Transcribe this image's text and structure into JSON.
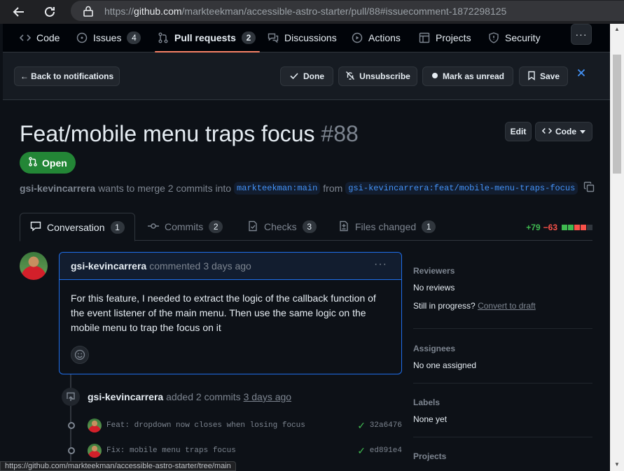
{
  "browser": {
    "url_scheme": "https://",
    "url_host": "github.com",
    "url_path": "/markteekman/accessible-astro-starter/pull/88#issuecomment-1872298125",
    "status_url": "https://github.com/markteekman/accessible-astro-starter/tree/main"
  },
  "repo_nav": {
    "tabs": [
      {
        "label": "Code",
        "icon": "code-icon"
      },
      {
        "label": "Issues",
        "icon": "issue-icon",
        "count": "4"
      },
      {
        "label": "Pull requests",
        "icon": "pull-request-icon",
        "count": "2",
        "active": true
      },
      {
        "label": "Discussions",
        "icon": "discussions-icon"
      },
      {
        "label": "Actions",
        "icon": "play-icon"
      },
      {
        "label": "Projects",
        "icon": "table-icon"
      },
      {
        "label": "Security",
        "icon": "shield-icon"
      }
    ],
    "more_label": "···"
  },
  "notification_bar": {
    "back_label": "← Back to notifications",
    "done_label": "Done",
    "unsubscribe_label": "Unsubscribe",
    "mark_unread_label": "Mark as unread",
    "save_label": "Save"
  },
  "pr": {
    "title": "Feat/mobile menu traps focus",
    "number": "#88",
    "edit_label": "Edit",
    "code_label": "Code",
    "state": "Open",
    "author": "gsi-kevincarrera",
    "merge_text": "wants to merge 2 commits into",
    "base_branch": "markteekman:main",
    "from_text": "from",
    "head_branch": "gsi-kevincarrera:feat/mobile-menu-traps-focus"
  },
  "pr_tabs": [
    {
      "label": "Conversation",
      "count": "1",
      "icon": "comment-icon"
    },
    {
      "label": "Commits",
      "count": "2",
      "icon": "commit-icon"
    },
    {
      "label": "Checks",
      "count": "3",
      "icon": "checklist-icon"
    },
    {
      "label": "Files changed",
      "count": "1",
      "icon": "file-diff-icon"
    }
  ],
  "diffstat": {
    "additions": "+79",
    "deletions": "−63"
  },
  "colors": {
    "green": "#3fb950",
    "red": "#f85149",
    "accent": "#1f6feb",
    "open": "#238636"
  },
  "comment": {
    "author": "gsi-kevincarrera",
    "action": "commented",
    "time": "3 days ago",
    "body": "For this feature, I needed to extract the logic of the callback function of the event listener of the main menu. Then use the same logic on the mobile menu to trap the focus on it"
  },
  "timeline": {
    "author": "gsi-kevincarrera",
    "action": "added 2 commits",
    "time": "3 days ago",
    "commits": [
      {
        "message": "Feat: dropdown now closes when losing focus",
        "sha": "32a6476"
      },
      {
        "message": "Fix: mobile menu traps focus",
        "sha": "ed891e4"
      }
    ]
  },
  "sidebar": {
    "reviewers_heading": "Reviewers",
    "reviewers_value": "No reviews",
    "in_progress_text": "Still in progress?",
    "convert_link": "Convert to draft",
    "assignees_heading": "Assignees",
    "assignees_value": "No one assigned",
    "labels_heading": "Labels",
    "labels_value": "None yet",
    "projects_heading": "Projects"
  }
}
